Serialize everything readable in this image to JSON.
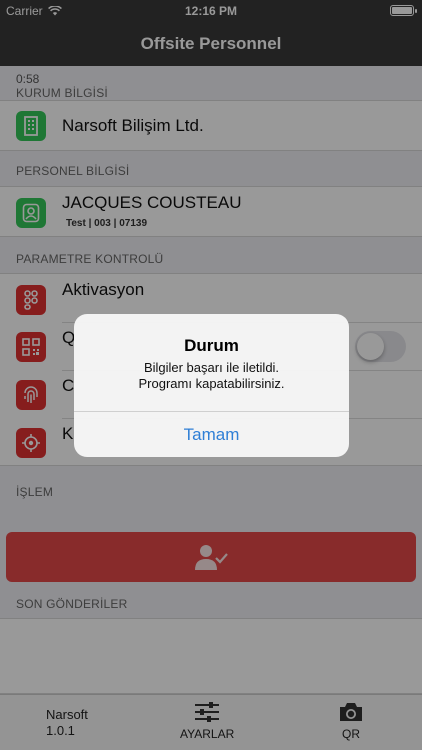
{
  "status_bar": {
    "carrier": "Carrier",
    "time": "12:16 PM"
  },
  "nav": {
    "title": "Offsite Personnel"
  },
  "timer": "0:58",
  "sections": {
    "kurum": {
      "header": "KURUM BİLGİSİ",
      "company": "Narsoft Bilişim Ltd.",
      "icon": "building-icon"
    },
    "personel": {
      "header": "PERSONEL BİLGİSİ",
      "name": "JACQUES COUSTEAU",
      "detail": "Test | 003 | 07139",
      "icon": "person-icon"
    },
    "parametre": {
      "header": "PARAMETRE KONTROLÜ",
      "items": [
        {
          "label": "Aktivasyon",
          "icon": "activation-icon"
        },
        {
          "label": "Q",
          "icon": "qr-code-icon"
        },
        {
          "label": "C",
          "icon": "fingerprint-icon"
        },
        {
          "label": "K",
          "icon": "location-target-icon"
        }
      ],
      "qr_toggle": false
    },
    "islem": {
      "header": "İŞLEM"
    },
    "son": {
      "header": "SON GÖNDERİLER"
    }
  },
  "tab_bar": {
    "company": "Narsoft",
    "version": "1.0.1",
    "settings_label": "AYARLAR",
    "qr_label": "QR"
  },
  "alert": {
    "title": "Durum",
    "line1": "Bilgiler başarı ile iletildi.",
    "line2": "Programı kapatabilirsiniz.",
    "button": "Tamam"
  },
  "colors": {
    "bar": "#3a3a3a",
    "green_icon": "#35c759",
    "red_icon": "#e03131",
    "action_button": "#e34949",
    "alert_button": "#2f7fd6"
  }
}
